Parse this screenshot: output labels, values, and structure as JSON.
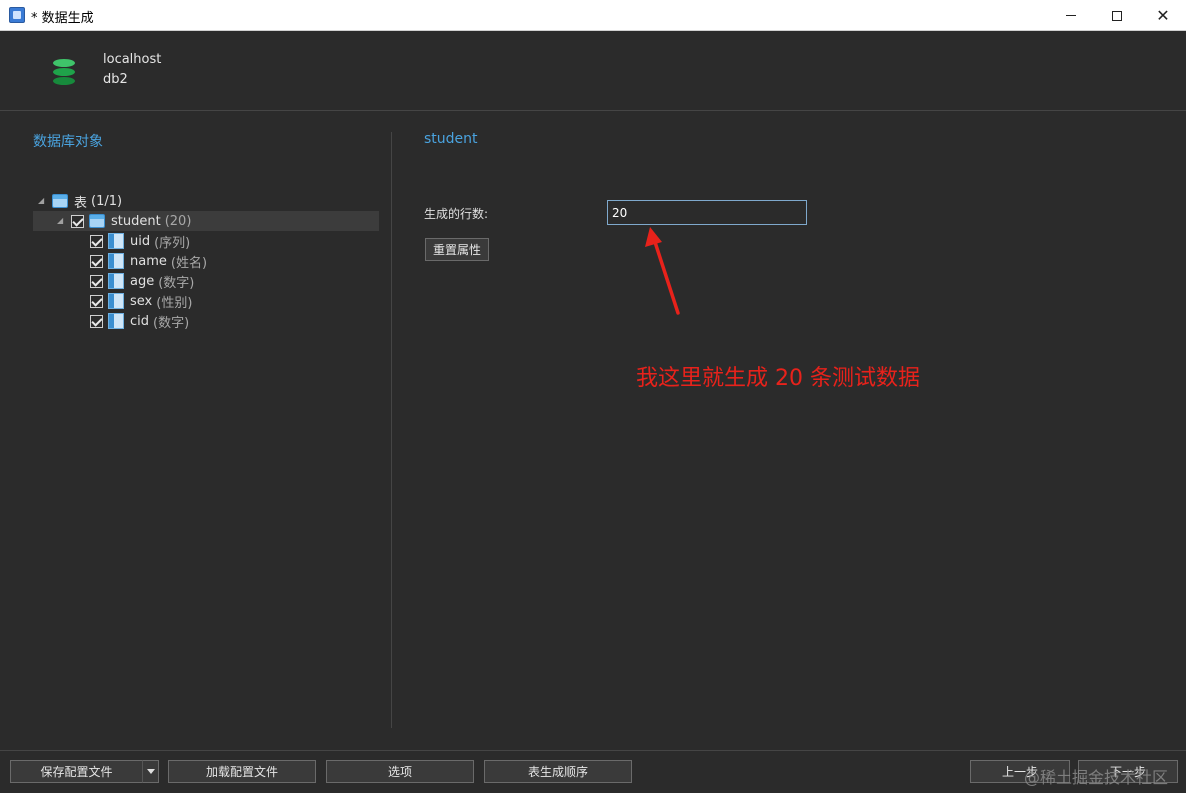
{
  "window": {
    "title": "* 数据生成"
  },
  "header": {
    "host": "localhost",
    "database": "db2"
  },
  "left_panel": {
    "title": "数据库对象",
    "tree": {
      "root_label": "表",
      "root_count": "(1/1)",
      "table": {
        "name": "student",
        "rows": "(20)"
      },
      "columns": [
        {
          "name": "uid",
          "type": "(序列)"
        },
        {
          "name": "name",
          "type": "(姓名)"
        },
        {
          "name": "age",
          "type": "(数字)"
        },
        {
          "name": "sex",
          "type": "(性别)"
        },
        {
          "name": "cid",
          "type": "(数字)"
        }
      ]
    }
  },
  "right_panel": {
    "title": "student",
    "rows_label": "生成的行数:",
    "rows_value": "20",
    "reset_label": "重置属性"
  },
  "annotation": {
    "text": "我这里就生成 20 条测试数据",
    "color": "#e8221b"
  },
  "footer": {
    "save_config": "保存配置文件",
    "load_config": "加载配置文件",
    "options": "选项",
    "table_order": "表生成顺序",
    "prev": "上一步",
    "next": "下一步"
  },
  "watermark": "@稀土掘金技术社区",
  "colors": {
    "accent": "#4aa3df",
    "background": "#2b2b2b",
    "db_icon": "#1fa34a"
  }
}
